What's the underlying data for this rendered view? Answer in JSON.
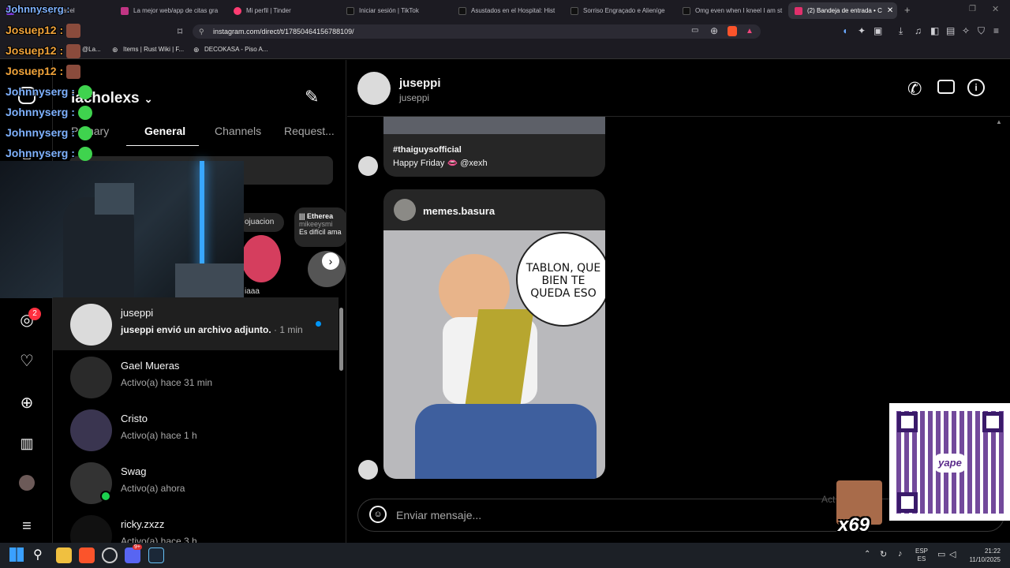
{
  "browser": {
    "tabs": [
      {
        "label": "Johnnyserg : iCanel",
        "color": "#7a3ad8"
      },
      {
        "label": "La mejor web/app de citas gra",
        "color": "#c13584"
      },
      {
        "label": "Mi perfil | Tinder",
        "color": "#fe3c72"
      },
      {
        "label": "Iniciar sesión | TikTok",
        "color": "#222"
      },
      {
        "label": "Asustados en el Hospital: Hist",
        "color": "#222"
      },
      {
        "label": "Sorriso Engraçado e Alieníge",
        "color": "#222"
      },
      {
        "label": "Omg even when I kneel I am st",
        "color": "#222"
      },
      {
        "label": "(2) Bandeja de entrada • C",
        "color": "#e1306c"
      }
    ],
    "url": "instagram.com/direct/t/17850464156788109/",
    "bookmarks": [
      "@La...",
      "Items | Rust Wiki | F...",
      "DECOKASA - Piso A..."
    ]
  },
  "stream_chat": [
    {
      "user": "Josuep12 :",
      "color": "#f0a33a"
    },
    {
      "user": "Josuep12 :",
      "color": "#f0a33a"
    },
    {
      "user": "Josuep12 :",
      "color": "#f0a33a"
    },
    {
      "user": "Johnnyserg :",
      "color": "#7fb2ff"
    },
    {
      "user": "Johnnyserg :",
      "color": "#7fb2ff"
    },
    {
      "user": "Johnnyserg :",
      "color": "#7fb2ff"
    },
    {
      "user": "Johnnyserg :",
      "color": "#7fb2ff"
    }
  ],
  "sidebar": {
    "account": "lacholexs",
    "tabs": [
      "Primary",
      "General",
      "Channels",
      "Request..."
    ],
    "selected_tab": "General",
    "notes": [
      "ojuacion",
      "||| Etherea",
      "mikeeysmi",
      "Es difícil ama",
      "iaaa"
    ],
    "messenger_badge": "2"
  },
  "conversations": [
    {
      "name": "juseppi",
      "sub": "juseppi envió un archivo adjunto.",
      "time": "· 1 min",
      "unread": true
    },
    {
      "name": "Gael Mueras",
      "sub": "Activo(a) hace 31 min"
    },
    {
      "name": "Cristo",
      "sub": "Activo(a) hace 1 h"
    },
    {
      "name": "Swag",
      "sub": "Activo(a) ahora"
    },
    {
      "name": "ricky.zxzz",
      "sub": "Activo(a) hace 3 h"
    }
  ],
  "chat": {
    "name": "juseppi",
    "username": "juseppi",
    "post1_caption_1": "#thaiguysofficial",
    "post1_caption_2": "Happy Friday 👄 @xexh",
    "post2_account": "memes.basura",
    "meme_text": "TABLON, QUE BIEN TE QUEDA ESO",
    "composer_placeholder": "Enviar mensaje..."
  },
  "overlay": {
    "qr_label": "yape",
    "counter": "x69",
    "activate_text": "Act"
  },
  "taskbar": {
    "lang1": "ESP",
    "lang2": "ES",
    "time": "21:22",
    "date": "11/10/2025",
    "discord_badge": "9+"
  }
}
